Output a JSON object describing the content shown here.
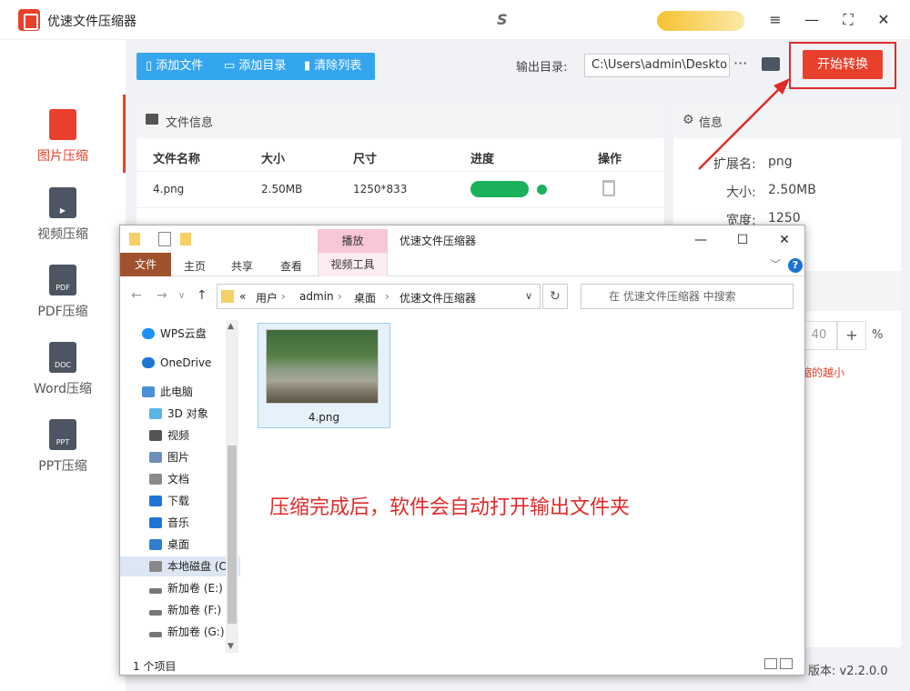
{
  "app": {
    "title": "优速文件压缩器",
    "brand_glyph": "S",
    "window_buttons": [
      "≡",
      "—",
      "⛶",
      "✕"
    ]
  },
  "sidebar": {
    "items": [
      {
        "label": "图片压缩",
        "icon_text": "",
        "active": true
      },
      {
        "label": "视频压缩",
        "icon_text": "▶",
        "active": false
      },
      {
        "label": "PDF压缩",
        "icon_text": "PDF",
        "active": false
      },
      {
        "label": "Word压缩",
        "icon_text": "DOC",
        "active": false
      },
      {
        "label": "PPT压缩",
        "icon_text": "PPT",
        "active": false
      }
    ]
  },
  "toolbar": {
    "add_file": "添加文件",
    "add_dir": "添加目录",
    "clear_list": "清除列表",
    "output_label": "输出目录:",
    "output_path": "C:\\Users\\admin\\Deskto",
    "more": "···",
    "start": "开始转换"
  },
  "files": {
    "header": "文件信息",
    "columns": [
      "文件名称",
      "大小",
      "尺寸",
      "进度",
      "操作"
    ],
    "rows": [
      {
        "name": "4.png",
        "size": "2.50MB",
        "dims": "1250*833",
        "progress": 1.0
      }
    ]
  },
  "info": {
    "header": "信息",
    "ext_label": "扩展名:",
    "ext_value": "png",
    "size_label": "大小:",
    "size_value": "2.50MB",
    "width_label": "宽度:",
    "width_value": "1250",
    "quality_value": "40",
    "plus": "+",
    "percent": "%",
    "hint": "缩的越小",
    "version": "版本: v2.2.0.0"
  },
  "explorer": {
    "play_tab": "播放",
    "title": "优速文件压缩器",
    "buttons": [
      "—",
      "☐",
      "✕"
    ],
    "tabs": [
      "文件",
      "主页",
      "共享",
      "查看",
      "视频工具"
    ],
    "help": "?",
    "breadcrumbs": [
      "«",
      "用户",
      "admin",
      "桌面",
      "优速文件压缩器"
    ],
    "search_placeholder": "在 优速文件压缩器 中搜索",
    "nav": [
      {
        "label": "WPS云盘",
        "color": "#1e90ff"
      },
      {
        "label": "OneDrive",
        "color": "#1e74d5"
      },
      {
        "label": "此电脑",
        "color": "#4a90d9"
      },
      {
        "label": "3D 对象",
        "color": "#5ab4e6"
      },
      {
        "label": "视频",
        "color": "#555555"
      },
      {
        "label": "图片",
        "color": "#6b8fb8"
      },
      {
        "label": "文档",
        "color": "#8a8a8a"
      },
      {
        "label": "下载",
        "color": "#1e74d5"
      },
      {
        "label": "音乐",
        "color": "#1e74d5"
      },
      {
        "label": "桌面",
        "color": "#2f7fd0"
      },
      {
        "label": "本地磁盘 (C",
        "color": "#888888"
      },
      {
        "label": "新加卷 (E:)",
        "color": "#777777"
      },
      {
        "label": "新加卷 (F:)",
        "color": "#777777"
      },
      {
        "label": "新加卷 (G:)",
        "color": "#777777"
      }
    ],
    "file": {
      "name": "4.png"
    },
    "note": "压缩完成后，软件会自动打开输出文件夹",
    "status": "1 个项目"
  }
}
